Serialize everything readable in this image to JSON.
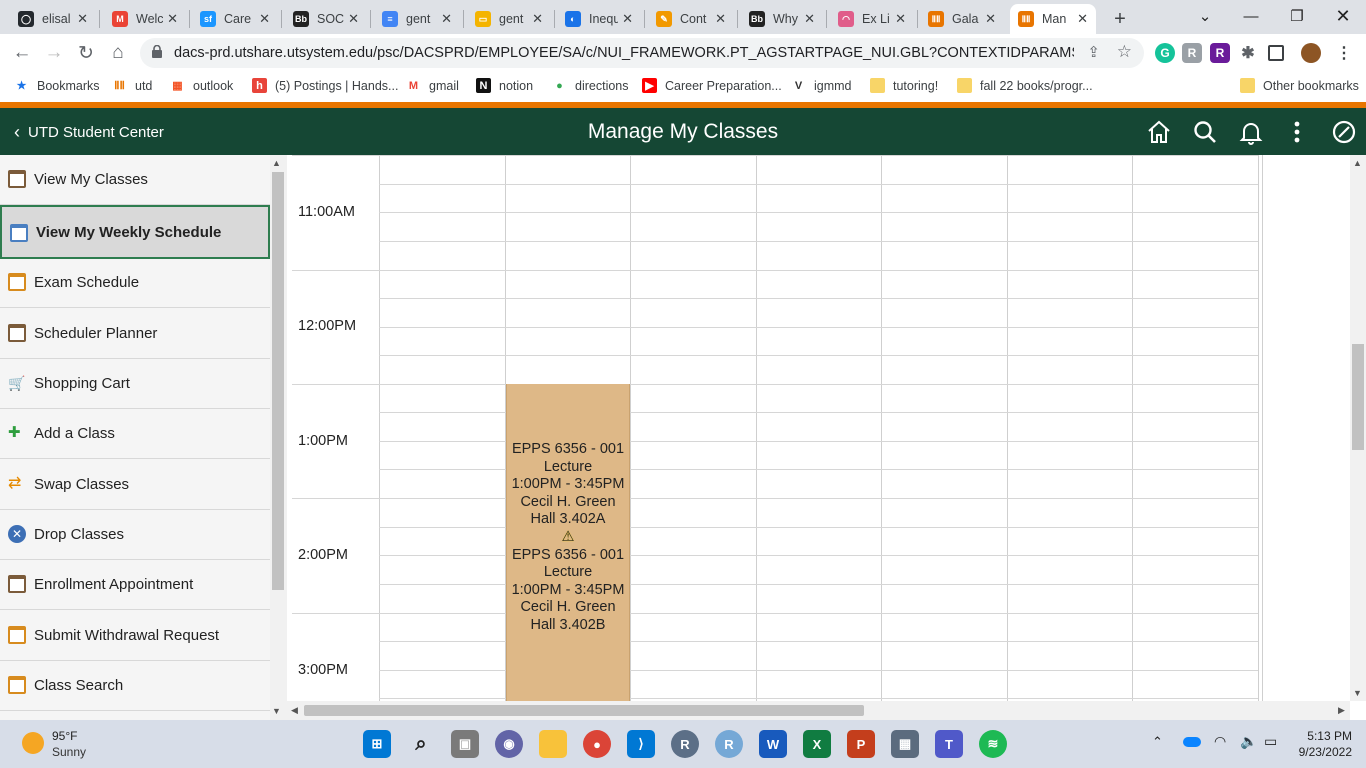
{
  "browser": {
    "tabs": [
      {
        "title": "elisal",
        "icon": "github-icon",
        "color": "#24292e"
      },
      {
        "title": "Welc",
        "icon": "gmail-icon",
        "color": "#ea4335"
      },
      {
        "title": "Care",
        "icon": "salesforce-icon",
        "color": "#1b96ff"
      },
      {
        "title": "SOCI",
        "icon": "blackboard-icon",
        "color": "#222222"
      },
      {
        "title": "gent",
        "icon": "google-docs-icon",
        "color": "#4285f4"
      },
      {
        "title": "gent",
        "icon": "google-slides-icon",
        "color": "#f4b400"
      },
      {
        "title": "Inequ",
        "icon": "site-icon",
        "color": "#1a73e8"
      },
      {
        "title": "Cont",
        "icon": "notes-icon",
        "color": "#f29900"
      },
      {
        "title": "Why",
        "icon": "blackboard-icon",
        "color": "#222222"
      },
      {
        "title": "Ex Li",
        "icon": "rainbow-icon",
        "color": "#e05d8a"
      },
      {
        "title": "Gala",
        "icon": "utd-icon",
        "color": "#e87500"
      },
      {
        "title": "Man",
        "icon": "utd-icon",
        "color": "#e87500",
        "active": true
      }
    ],
    "url": "dacs-prd.utshare.utsystem.edu/psc/DACSPRD/EMPLOYEE/SA/c/NUI_FRAMEWORK.PT_AGSTARTPAGE_NUI.GBL?CONTEXTIDPARAMS=TEMPLATE_...",
    "bookmarks": [
      {
        "label": "Bookmarks",
        "icon": "star-icon"
      },
      {
        "label": "utd",
        "icon": "utd-icon"
      },
      {
        "label": "outlook",
        "icon": "windows-icon"
      },
      {
        "label": "(5) Postings | Hands...",
        "icon": "handshake-icon"
      },
      {
        "label": "gmail",
        "icon": "gmail-icon"
      },
      {
        "label": "notion",
        "icon": "notion-icon"
      },
      {
        "label": "directions",
        "icon": "maps-pin-icon"
      },
      {
        "label": "Career Preparation...",
        "icon": "youtube-icon"
      },
      {
        "label": "igmmd",
        "icon": "v-icon"
      },
      {
        "label": "tutoring!",
        "icon": "folder-icon"
      },
      {
        "label": "fall 22 books/progr...",
        "icon": "folder-icon"
      }
    ],
    "other_bookmarks": "Other bookmarks"
  },
  "app": {
    "back_label": "UTD Student Center",
    "title": "Manage My Classes",
    "header_color": "#154734",
    "accent_color": "#e87500"
  },
  "sidebar": {
    "items": [
      {
        "label": "View My Classes",
        "icon": "calendar-list-icon"
      },
      {
        "label": "View My Weekly Schedule",
        "icon": "calendar-icon",
        "selected": true
      },
      {
        "label": "Exam Schedule",
        "icon": "exam-icon"
      },
      {
        "label": "Scheduler Planner",
        "icon": "planner-icon"
      },
      {
        "label": "Shopping Cart",
        "icon": "cart-icon"
      },
      {
        "label": "Add a Class",
        "icon": "plus-icon"
      },
      {
        "label": "Swap Classes",
        "icon": "swap-icon"
      },
      {
        "label": "Drop Classes",
        "icon": "drop-icon"
      },
      {
        "label": "Enrollment Appointment",
        "icon": "appointment-icon"
      },
      {
        "label": "Submit Withdrawal Request",
        "icon": "withdrawal-icon"
      },
      {
        "label": "Class Search",
        "icon": "search-calendar-icon"
      }
    ]
  },
  "schedule": {
    "times": [
      "11:00AM",
      "12:00PM",
      "1:00PM",
      "2:00PM",
      "3:00PM"
    ],
    "event": {
      "block1": {
        "course": "EPPS 6356 - 001",
        "type": "Lecture",
        "time": "1:00PM - 3:45PM",
        "location": "Cecil H. Green Hall 3.402A"
      },
      "warning": "⚠",
      "block2": {
        "course": "EPPS 6356 - 001",
        "type": "Lecture",
        "time": "1:00PM - 3:45PM",
        "location": "Cecil H. Green Hall 3.402B"
      },
      "color": "#deb887"
    }
  },
  "taskbar": {
    "weather_temp": "95°F",
    "weather_desc": "Sunny",
    "time": "5:13 PM",
    "date": "9/23/2022"
  }
}
